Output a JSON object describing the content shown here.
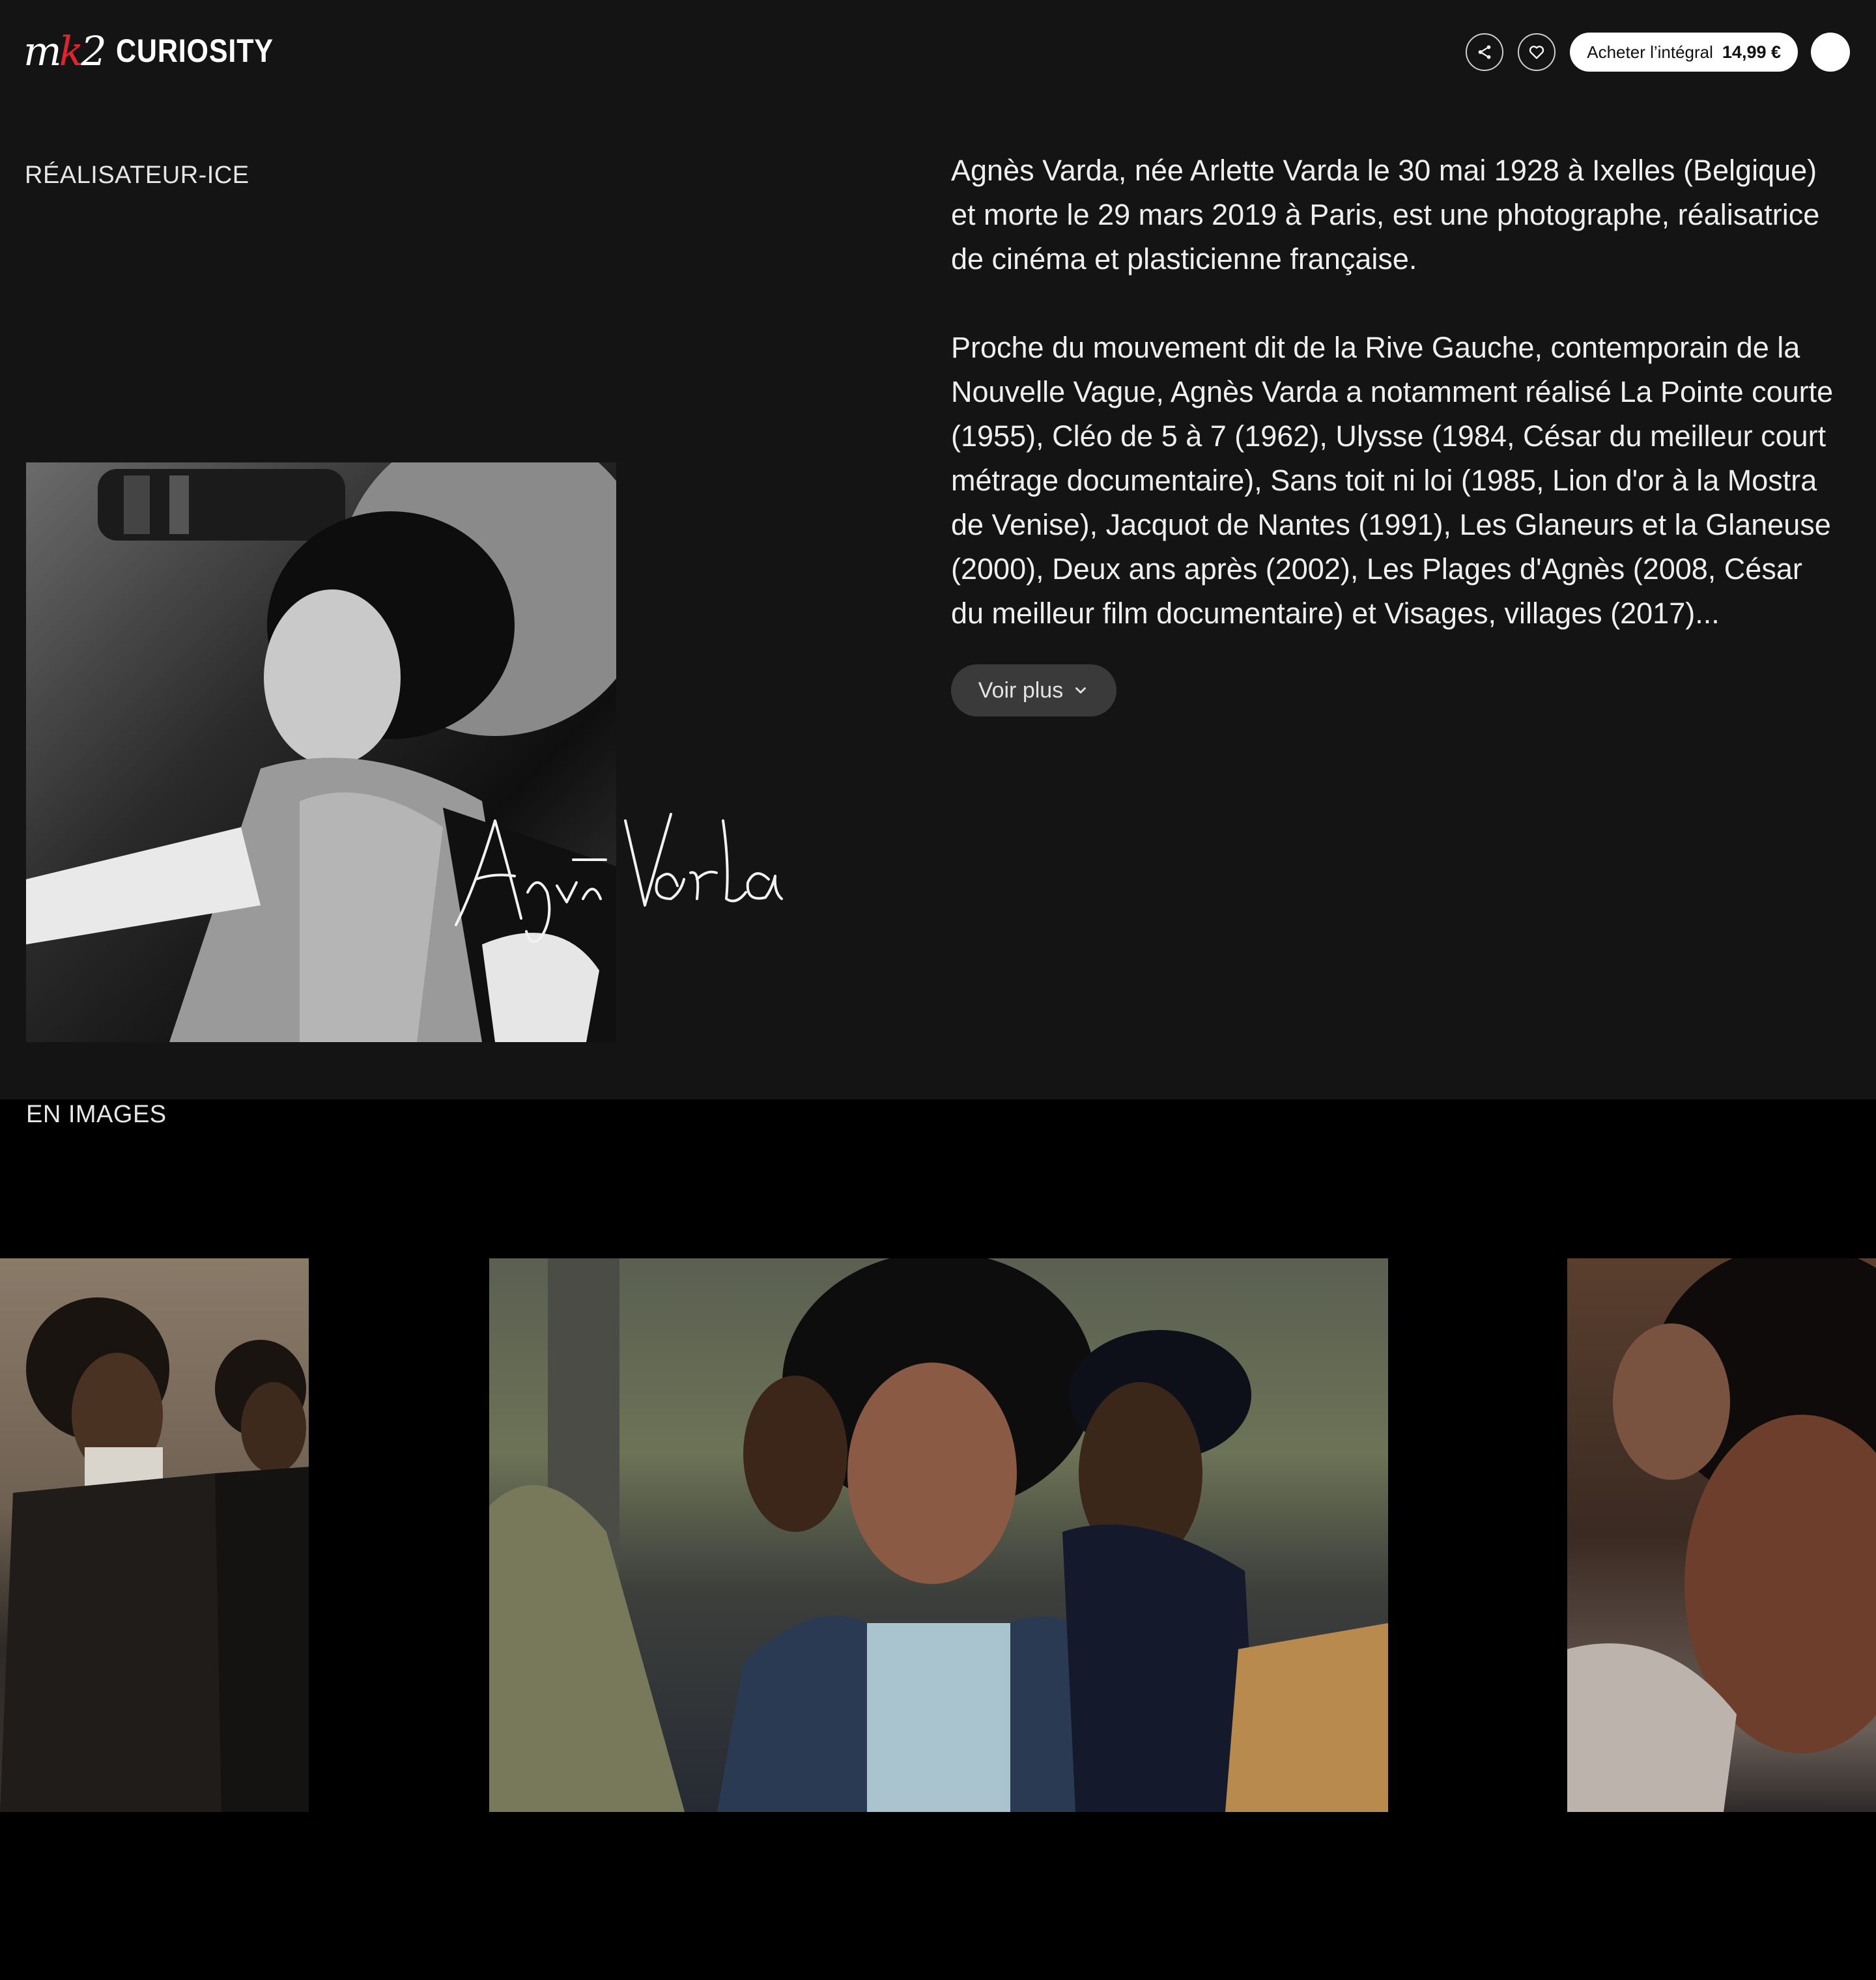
{
  "header": {
    "logo_mark": "mk2",
    "logo_brand": "CURIOSITY",
    "buy_label": "Acheter l’intégral",
    "buy_price": "14,99 €",
    "icons": [
      "share-icon",
      "heart-icon"
    ]
  },
  "director": {
    "section_label": "RÉALISATEUR-ICE",
    "signature": "Agnès Varda",
    "bio": [
      "Agnès Varda, née Arlette Varda le 30 mai 1928 à Ixelles (Belgique) et morte le 29 mars 2019 à Paris, est une photographe, réalisatrice de cinéma et plasticienne française.",
      "Proche du mouvement dit de la Rive Gauche, contemporain de la Nouvelle Vague, Agnès Varda a notamment réalisé La Pointe courte (1955), Cléo de 5 à 7 (1962), Ulysse (1984, César du meilleur court métrage documentaire), Sans toit ni loi (1985, Lion d'or à la Mostra de Venise), Jacquot de Nantes (1991), Les Glaneurs et la Glaneuse (2000), Deux ans après (2002), Les Plages d'Agnès (2008, César du meilleur film documentaire) et Visages, villages (2017)..."
    ],
    "more_label": "Voir plus"
  },
  "gallery": {
    "section_label": "EN IMAGES",
    "items": [
      "film-still-1",
      "film-still-2",
      "film-still-3"
    ]
  },
  "colors": {
    "top_background": "#141414",
    "page_background": "#000000",
    "accent_red": "#e0242f",
    "button_dark": "#3a3a3a"
  }
}
